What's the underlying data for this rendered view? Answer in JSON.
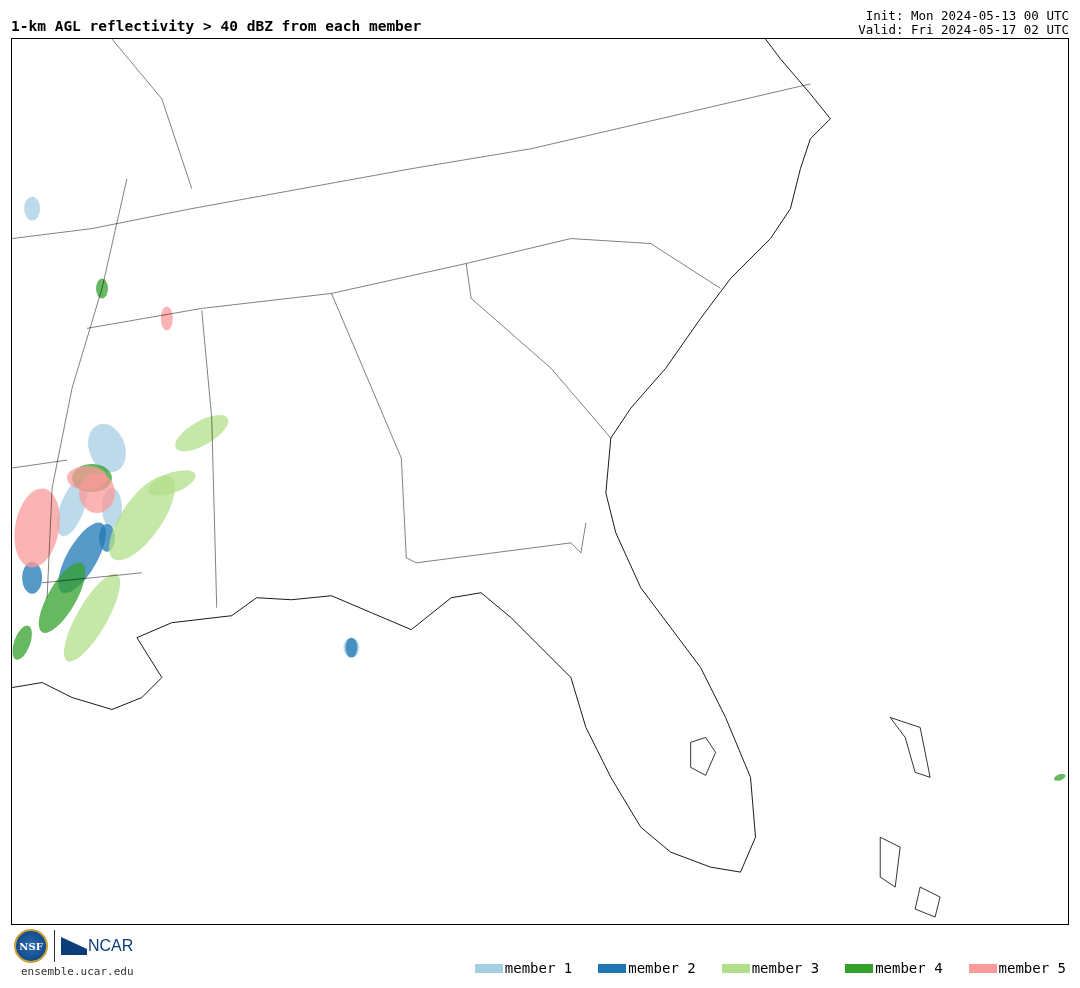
{
  "title": "1-km AGL reflectivity > 40 dBZ from each member",
  "init": "Init: Mon 2024-05-13 00 UTC",
  "valid": "Valid: Fri 2024-05-17 02 UTC",
  "logos": {
    "nsf": "NSF",
    "ncar": "NCAR"
  },
  "site": "ensemble.ucar.edu",
  "legend": [
    {
      "label": "member 1",
      "color": "#a6cee3"
    },
    {
      "label": "member 2",
      "color": "#1f78b4"
    },
    {
      "label": "member 3",
      "color": "#b2df8a"
    },
    {
      "label": "member 4",
      "color": "#33a02c"
    },
    {
      "label": "member 5",
      "color": "#fb9a99"
    }
  ]
}
